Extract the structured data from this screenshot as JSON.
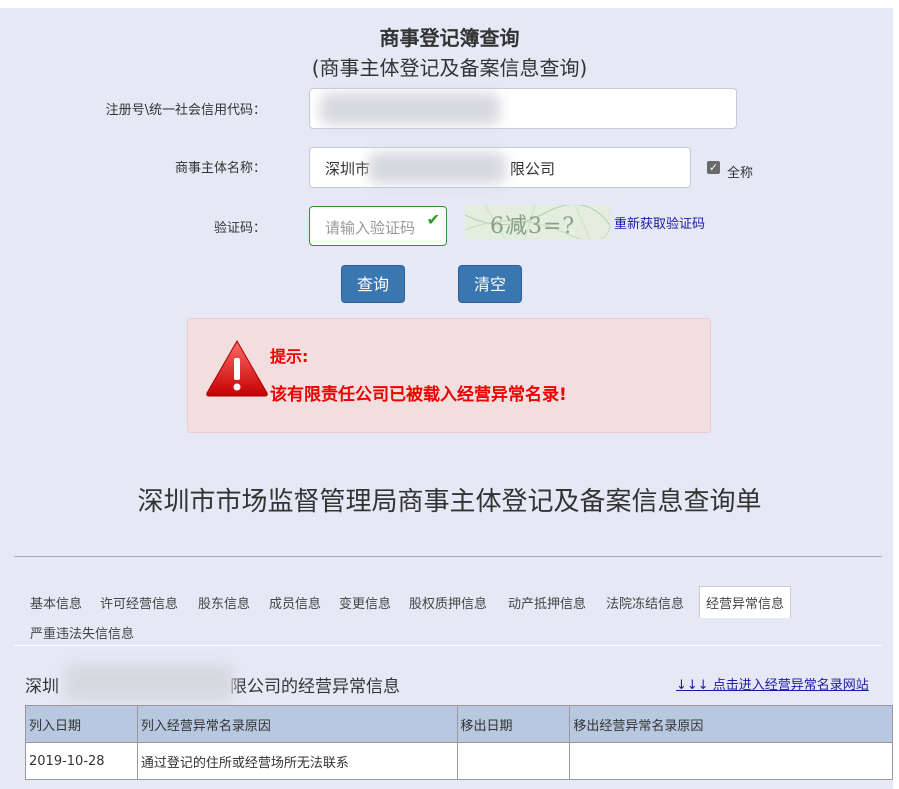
{
  "header": {
    "title": "商事登记簿查询",
    "subtitle": "(商事主体登记及备案信息查询)"
  },
  "form": {
    "reg_label": "注册号\\统一社会信用代码：",
    "name_label": "商事主体名称：",
    "name_prefix": "深圳市",
    "name_suffix": "限公司",
    "fullname_label": "全称",
    "fullname_checked": true,
    "captcha_label": "验证码：",
    "captcha_placeholder": "请输入验证码",
    "captcha_image_text": "6减3=?",
    "refresh_captcha": "重新获取验证码",
    "query_button": "查询",
    "clear_button": "清空"
  },
  "alert": {
    "title": "提示:",
    "message": "该有限责任公司已被载入经营异常名录!"
  },
  "document_title": "深圳市市场监督管理局商事主体登记及备案信息查询单",
  "tabs": [
    "基本信息",
    "许可经营信息",
    "股东信息",
    "成员信息",
    "变更信息",
    "股权质押信息",
    "动产抵押信息",
    "法院冻结信息",
    "经营异常信息",
    "严重违法失信信息"
  ],
  "active_tab": "经营异常信息",
  "section": {
    "title_prefix": "深圳",
    "title_suffix": "限公司的经营异常信息",
    "link": "↓↓↓ 点击进入经营异常名录网站"
  },
  "table": {
    "columns": [
      "列入日期",
      "列入经营异常名录原因",
      "移出日期",
      "移出经营异常名录原因"
    ],
    "rows": [
      [
        "2019-10-28",
        "通过登记的住所或经营场所无法联系",
        "",
        ""
      ]
    ]
  },
  "colors": {
    "background": "#e6e8f6",
    "button": "#3a76b0",
    "alert_bg": "#f2dede",
    "alert_text": "#ee0000",
    "table_header": "#b8c8e0"
  }
}
